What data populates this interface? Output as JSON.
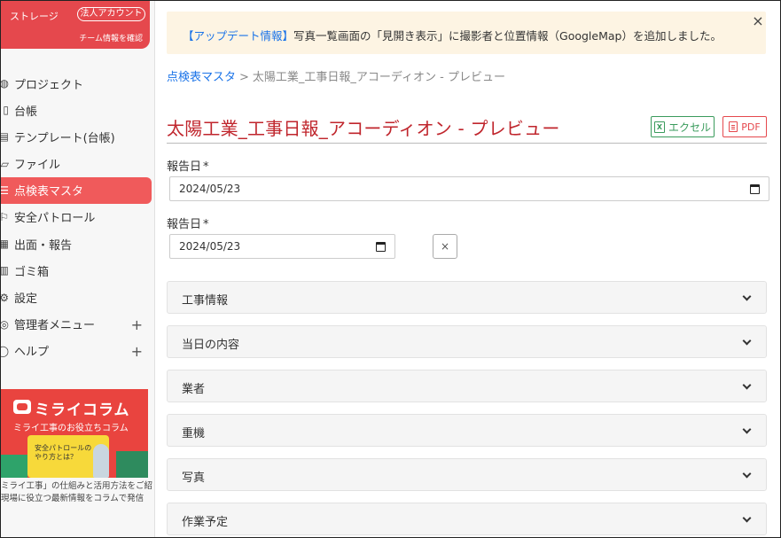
{
  "sidebar": {
    "storage_label": "ストレージ",
    "corp_badge": "法人アカウント",
    "team_link": "チーム情報を確認",
    "items": [
      {
        "label": "プロジェクト",
        "icon": "globe-icon"
      },
      {
        "label": "台帳",
        "icon": "ledger-icon"
      },
      {
        "label": "テンプレート(台帳)",
        "icon": "template-icon"
      },
      {
        "label": "ファイル",
        "icon": "file-icon"
      },
      {
        "label": "点検表マスタ",
        "icon": "checklist-icon",
        "active": true
      },
      {
        "label": "安全パトロール",
        "icon": "patrol-icon"
      },
      {
        "label": "出面・報告",
        "icon": "report-icon"
      },
      {
        "label": "ゴミ箱",
        "icon": "trash-icon"
      },
      {
        "label": "設定",
        "icon": "gear-icon"
      },
      {
        "label": "管理者メニュー",
        "icon": "admin-icon",
        "expandable": true
      },
      {
        "label": "ヘルプ",
        "icon": "help-icon",
        "expandable": true
      }
    ],
    "banner": {
      "title": "ミライコラム",
      "subtitle": "ミライ工事のお役立ちコラム",
      "card_text": "安全パトロールの\nやり方とは？"
    },
    "note_line1": "ミライ工事」の仕組みと活用方法をご紹",
    "note_line2": "現場に役立つ最新情報をコラムで発信"
  },
  "alert": {
    "link_text": "【アップデート情報】",
    "message": "写真一覧画面の「見開き表示」に撮影者と位置情報（GoogleMap）を追加しました。",
    "close_symbol": "×"
  },
  "breadcrumb": {
    "parent": "点検表マスタ",
    "separator": ">",
    "current": "太陽工業_工事日報_アコーディオン - プレビュー"
  },
  "page_title": "太陽工業_工事日報_アコーディオン - プレビュー",
  "buttons": {
    "excel": "エクセル",
    "pdf": "PDF",
    "clear": "×"
  },
  "fields": [
    {
      "label": "報告日",
      "required_mark": "*",
      "value": "2024/05/23"
    },
    {
      "label": "報告日",
      "required_mark": "*",
      "value": "2024/05/23"
    }
  ],
  "sections": [
    "工事情報",
    "当日の内容",
    "業者",
    "重機",
    "写真",
    "作業予定"
  ]
}
